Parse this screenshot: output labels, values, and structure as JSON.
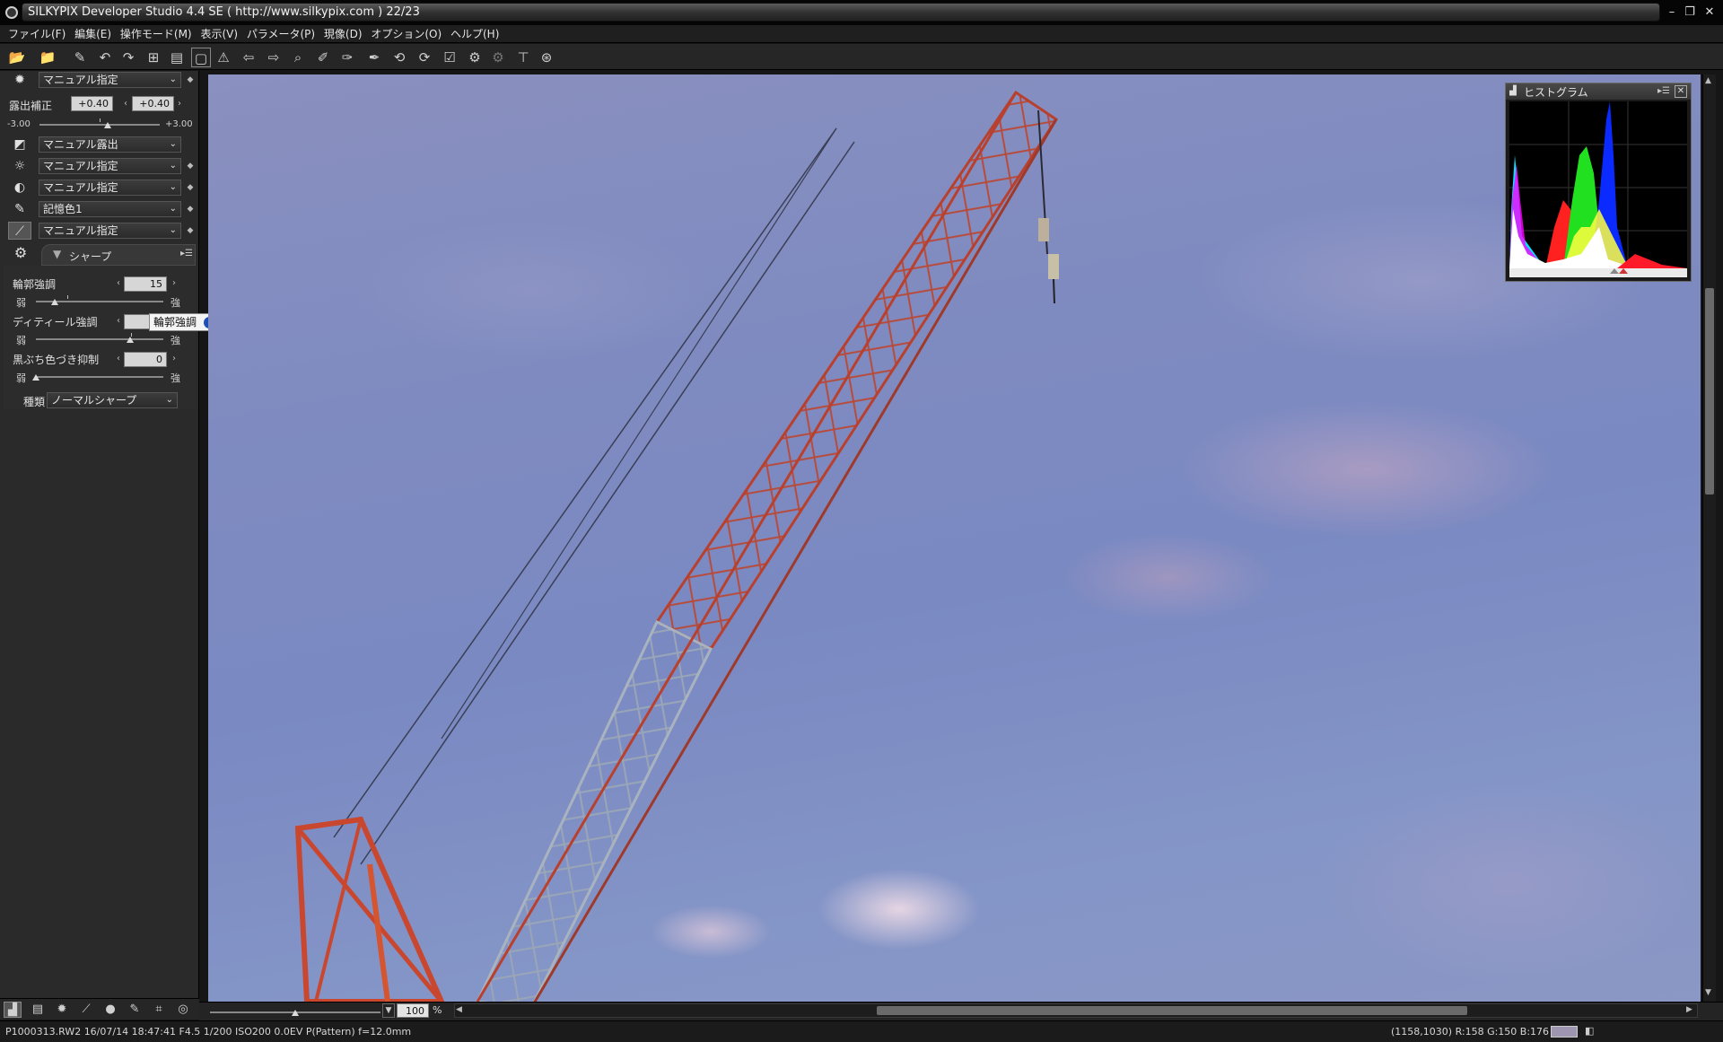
{
  "window": {
    "title": "SILKYPIX Developer Studio 4.4 SE ( http://www.silkypix.com )   22/23",
    "controls": {
      "minimize": "–",
      "restore": "❐",
      "close": "✕"
    }
  },
  "menu": [
    "ファイル(F)",
    "編集(E)",
    "操作モード(M)",
    "表示(V)",
    "パラメータ(P)",
    "現像(D)",
    "オプション(O)",
    "ヘルプ(H)"
  ],
  "toolbar_icons": [
    "open-folder-icon",
    "open-recent-icon",
    "eraser-icon",
    "undo-icon",
    "redo-icon",
    "grid-view-icon",
    "filmstrip-view-icon",
    "single-view-icon",
    "warning-icon",
    "previous-icon",
    "next-icon",
    "zoom-icon",
    "eyedropper-wb-icon",
    "eyedropper-gray-icon",
    "tone-picker-icon",
    "rotate-left-icon",
    "rotate-right-icon",
    "check-icon",
    "develop-icon",
    "batch-develop-icon",
    "crop-icon",
    "spot-icon"
  ],
  "left_panel": {
    "white_balance_select": "マニュアル指定",
    "exposure": {
      "label": "露出補正",
      "value_a": "+0.40",
      "value_b": "+0.40",
      "min": "-3.00",
      "max": "+3.00",
      "level": 0.57
    },
    "exposure_mode_select": "マニュアル露出",
    "brightness_select": "マニュアル指定",
    "contrast_select": "マニュアル指定",
    "color_select": "記憶色1",
    "sharp_select": "マニュアル指定",
    "sharp_tab_label": "シャープ",
    "sharp": {
      "outline_label": "輪郭強調",
      "outline_value": "15",
      "outline_level": 0.15,
      "detail_label": "ディティール強調",
      "detail_level": 0.74,
      "fringe_label": "黒ぶち色づき抑制",
      "fringe_value": "0",
      "fringe_level": 0.0,
      "weak": "弱",
      "strong": "強",
      "type_label": "種類",
      "type_value": "ノーマルシャープ"
    },
    "tooltip_text": "輪郭強調",
    "tooltip_info": "i"
  },
  "histogram": {
    "title": "ヒストグラム",
    "menu_glyph": "▸☰",
    "close_glyph": "✕"
  },
  "viewer": {
    "zoom_value": "100",
    "zoom_unit": "%",
    "zoom_level": 0.5
  },
  "status": {
    "left": "P1000313.RW2  16/07/14  18:47:41  F4.5  1/200  ISO200   0.0EV  P(Pattern)  f=12.0mm",
    "right": "(1158,1030)  R:158  G:150  B:176",
    "swatch_color": "#9e96b0"
  },
  "colors": {
    "accent_info": "#1e4fb6",
    "crane_red": "#b8402e",
    "crane_gray": "#aab4bf"
  }
}
